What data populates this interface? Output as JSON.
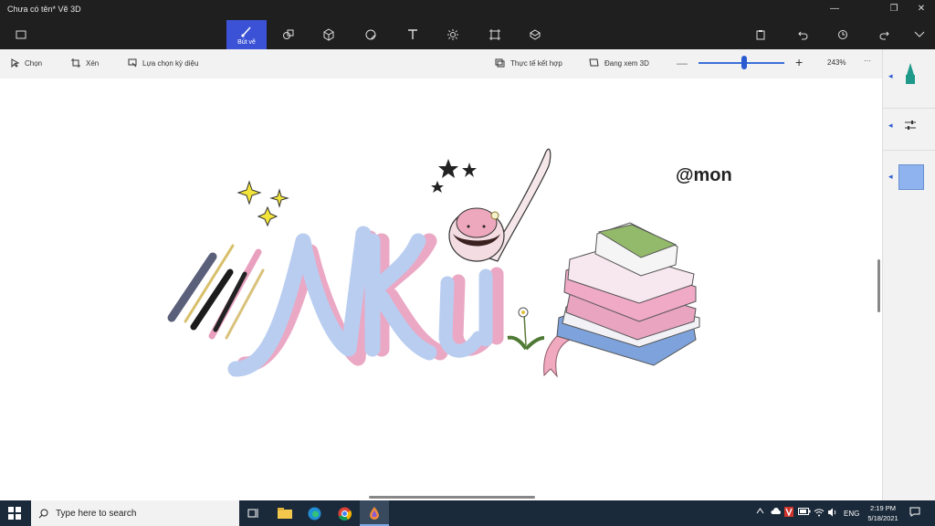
{
  "window": {
    "title": "Chưa có tên*   Vẽ 3D"
  },
  "toolbar": {
    "brushes_label": "Bút vẽ"
  },
  "subtoolbar": {
    "select": "Chọn",
    "crop": "Xén",
    "magic_select": "Lựa chọn kỳ diệu",
    "mixed_reality": "Thực tế kết hợp",
    "view_3d": "Đang xem 3D",
    "zoom": "243%"
  },
  "canvas": {
    "signature": "@mon",
    "art_text": "NKu"
  },
  "taskbar": {
    "search_placeholder": "Type here to search",
    "lang": "ENG",
    "time": "2:19 PM",
    "date": "5/18/2021"
  },
  "colors": {
    "accent": "#3b52d6",
    "lettering_blue": "#b9cdf0",
    "lettering_pink": "#eaa8c4",
    "selected_color": "#8fb3ef"
  }
}
